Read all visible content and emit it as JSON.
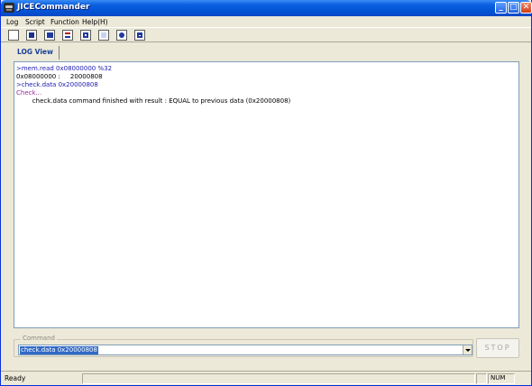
{
  "window": {
    "title": "JICECommander"
  },
  "title_buttons": {
    "minimize": "_",
    "maximize": "□",
    "close": "✕"
  },
  "menu": [
    {
      "label": "Log"
    },
    {
      "label": "Script"
    },
    {
      "label": "Function"
    },
    {
      "label": "Help(H)"
    }
  ],
  "toolbar": {
    "buttons": [
      "new-icon",
      "save-icon",
      "open-script-icon",
      "log-icon",
      "dump-icon",
      "text-icon",
      "run-icon",
      "window-icon"
    ]
  },
  "tabs": [
    {
      "label": "LOG View"
    }
  ],
  "log": {
    "lines": [
      {
        "text": ">mem.read 0x08000000 %32",
        "kind": "cmd"
      },
      {
        "text": "0x08000000 :     20000808",
        "kind": "out"
      },
      {
        "text": ">check.data 0x20000808",
        "kind": "cmd"
      },
      {
        "text": "Check...",
        "kind": "check"
      },
      {
        "text": "        check.data command finished with result : EQUAL to previous data (0x20000808)",
        "kind": "out"
      }
    ]
  },
  "command": {
    "legend": "Command",
    "value": "check.data 0x20000808"
  },
  "stop_button": {
    "label": "STOP"
  },
  "status": {
    "text": "Ready",
    "num": "NUM"
  },
  "colors": {
    "titlebar": "#0553d6",
    "log_cmd": "#1a1ab0",
    "log_check": "#9b2d9b",
    "selection": "#316ac5"
  }
}
